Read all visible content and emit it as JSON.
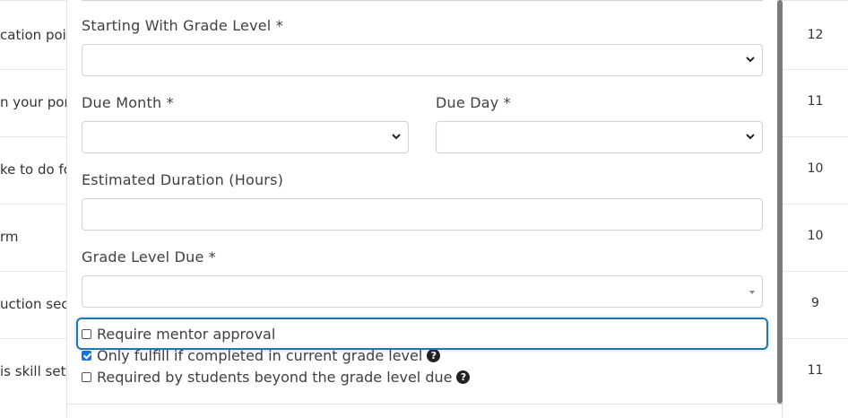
{
  "background_table": {
    "rows": [
      {
        "left_text": "cation poi",
        "right_value": "12"
      },
      {
        "left_text": "n your por",
        "right_value": "11"
      },
      {
        "left_text": "ke to do fo",
        "right_value": "10"
      },
      {
        "left_text": "rm",
        "right_value": "10"
      },
      {
        "left_text": "uction sec",
        "right_value": "9"
      },
      {
        "left_text": "is skill set",
        "right_value": "11"
      }
    ]
  },
  "form": {
    "starting_grade_label": "Starting With Grade Level *",
    "due_month_label": "Due Month *",
    "due_day_label": "Due Day *",
    "estimated_duration_label": "Estimated Duration (Hours)",
    "grade_level_due_label": "Grade Level Due *",
    "starting_grade_value": "",
    "due_month_value": "",
    "due_day_value": "",
    "estimated_duration_value": "",
    "grade_level_due_value": ""
  },
  "checkboxes": {
    "require_mentor": {
      "label": "Require mentor approval",
      "checked": false
    },
    "only_fulfill": {
      "label": "Only fulfill if completed in current grade level",
      "checked": true
    },
    "required_beyond": {
      "label": "Required by students beyond the grade level due",
      "checked": false
    }
  },
  "icons": {
    "help": "question-circle-icon",
    "chevron": "chevron-down-icon"
  },
  "colors": {
    "focus_border": "#1f78b4",
    "checkbox_checked": "#1a73e8"
  }
}
